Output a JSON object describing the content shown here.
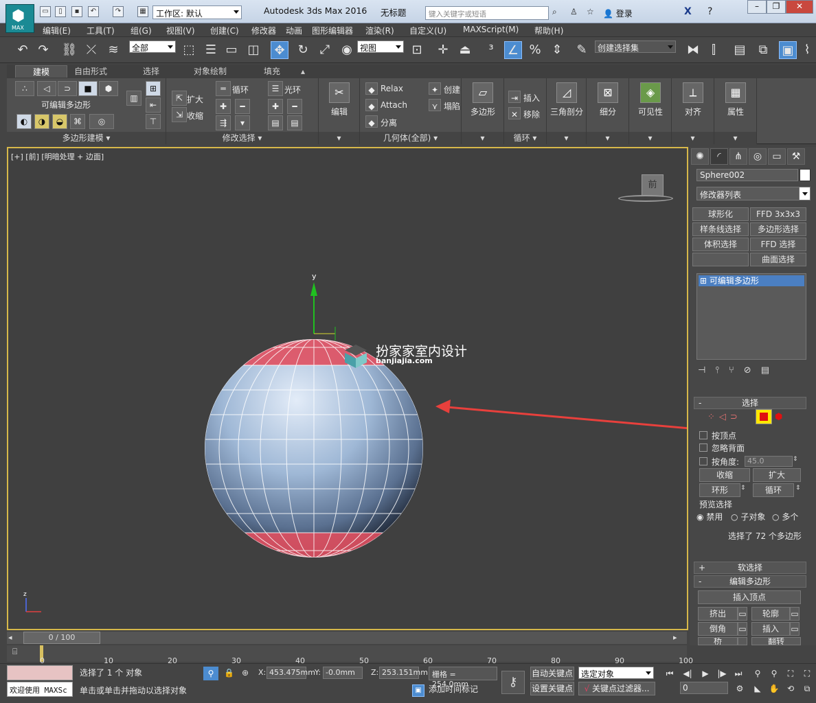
{
  "titlebar": {
    "logo_text": "MAX",
    "workspace": "工作区: 默认",
    "app_title": "Autodesk 3ds Max 2016",
    "doc_title": "无标题",
    "search_placeholder": "键入关键字或短语",
    "login": "登录"
  },
  "menu": [
    "编辑(E)",
    "工具(T)",
    "组(G)",
    "视图(V)",
    "创建(C)",
    "修改器",
    "动画",
    "图形编辑器",
    "渲染(R)",
    "自定义(U)",
    "MAXScript(M)",
    "帮助(H)"
  ],
  "toolbar": {
    "filter": "全部",
    "coord_system": "视图",
    "selection_set": "创建选择集"
  },
  "ribbon": {
    "tabs": [
      "建模",
      "自由形式",
      "选择",
      "对象绘制",
      "填充"
    ],
    "poly_label": "可编辑多边形",
    "poly_footer": "多边形建模",
    "mod_sel_footer": "修改选择",
    "grow": "扩大",
    "shrink": "收缩",
    "loop": "循环",
    "ring": "光环",
    "edit": "编辑",
    "relax": "Relax",
    "attach": "Attach",
    "detach": "分离",
    "create": "创建",
    "collapse": "塌陷",
    "geom_footer": "几何体(全部)",
    "polygon": "多边形",
    "insert": "插入",
    "remove": "移除",
    "loops_footer": "循环",
    "tri": "三角剖分",
    "subdiv": "细分",
    "visibility": "可见性",
    "align": "对齐",
    "props": "属性"
  },
  "viewport": {
    "label": "[+] [前] [明暗处理 + 边面]",
    "nav_cube": "前",
    "axis_y": "y",
    "axis_z": "z",
    "watermark": "扮家家室内设计",
    "watermark_url": "banjiajia.com"
  },
  "cmdpanel": {
    "object_name": "Sphere002",
    "modifier_list": "修改器列表",
    "modifier_buttons": [
      "球形化",
      "FFD 3x3x3",
      "样条线选择",
      "多边形选择",
      "体积选择",
      "FFD 选择",
      "",
      "曲面选择"
    ],
    "stack_item": "可编辑多边形",
    "selection_header": "选择",
    "by_vertex": "按顶点",
    "ignore_backfacing": "忽略背面",
    "by_angle": "按角度:",
    "angle_value": "45.0",
    "shrink": "收缩",
    "grow": "扩大",
    "ring": "环形",
    "loop": "循环",
    "preview_label": "预览选择",
    "preview_disabled": "禁用",
    "preview_subobj": "子对象",
    "preview_multi": "多个",
    "selection_info": "选择了 72 个多边形",
    "soft_selection": "软选择",
    "edit_polygons": "编辑多边形",
    "insert_vertex": "插入顶点",
    "extrude": "挤出",
    "outline": "轮廓",
    "bevel": "倒角",
    "inset": "插入",
    "bridge": "桥",
    "flip": "翻转"
  },
  "timeline": {
    "slider": "0 / 100",
    "ticks": [
      "0",
      "10",
      "20",
      "30",
      "40",
      "50",
      "60",
      "70",
      "80",
      "90",
      "100"
    ]
  },
  "status": {
    "maxscript": "欢迎使用 MAXSc",
    "selected": "选择了 1 个 对象",
    "prompt": "单击或单击并拖动以选择对象",
    "x_label": "X:",
    "x": "453.475mm",
    "y_label": "Y:",
    "y": "-0.0mm",
    "z_label": "Z:",
    "z": "253.151mm",
    "grid": "栅格 = 254.0mm",
    "add_time_tag": "添加时间标记",
    "auto_key": "自动关键点",
    "set_key": "设置关键点",
    "selected_objects": "选定对象",
    "key_filters": "关键点过滤器...",
    "frame": "0"
  },
  "colors": {
    "viewport_border": "#d7b84a",
    "selected_faces": "#e05060",
    "sphere": "#8ea8c8",
    "annotation_arrow": "#e8403c"
  }
}
